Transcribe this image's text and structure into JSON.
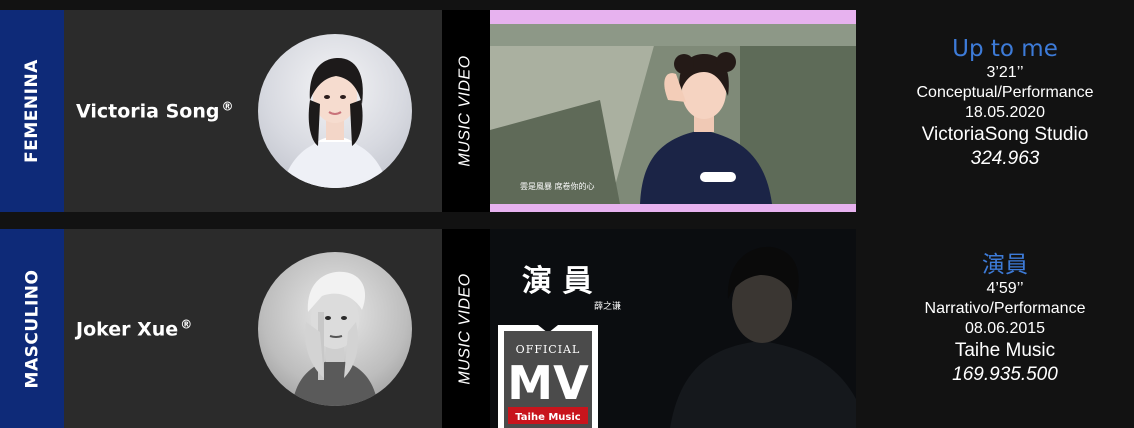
{
  "rows": [
    {
      "category": "FEMENINA",
      "artist": "Victoria Song",
      "reg": "®",
      "mv_label": "MUSIC VIDEO",
      "subtitle": "雲是風暴 席卷你的心",
      "song": {
        "title": "Up to me",
        "duration": "3’21’’",
        "style": "Conceptual/Performance",
        "date": "18.05.2020",
        "label": "VictoriaSong Studio",
        "views": "324.963"
      }
    },
    {
      "category": "MASCULINO",
      "artist": "Joker Xue",
      "reg": "®",
      "mv_label": "MUSIC VIDEO",
      "mv_title": "演 員",
      "mv_artist": "薛之谦",
      "badge_official": "OFFICIAL",
      "badge_mv": "MV",
      "badge_label": "Taihe Music",
      "song": {
        "title": "演員",
        "duration": "4’59’’",
        "style": "Narrativo/Performance",
        "date": "08.06.2015",
        "label": "Taihe Music",
        "views": "169.935.500"
      }
    }
  ],
  "colors": {
    "background": "#121212",
    "category_tab": "#0e2a78",
    "card": "#2b2b2b",
    "song_title": "#3d7bd8"
  }
}
